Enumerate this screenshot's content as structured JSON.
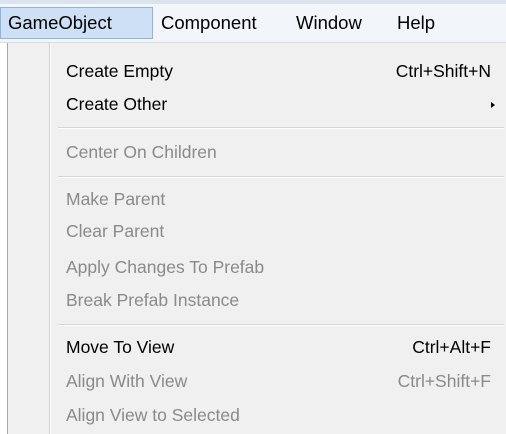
{
  "menubar": {
    "items": [
      {
        "label": "GameObject"
      },
      {
        "label": "Component"
      },
      {
        "label": "Window"
      },
      {
        "label": "Help"
      }
    ]
  },
  "menu": {
    "items": [
      {
        "label": "Create Empty",
        "shortcut": "Ctrl+Shift+N",
        "enabled": true
      },
      {
        "label": "Create Other",
        "shortcut": "",
        "enabled": true,
        "submenu": true
      },
      {
        "label": "Center On Children",
        "shortcut": "",
        "enabled": false
      },
      {
        "label": "Make Parent",
        "shortcut": "",
        "enabled": false
      },
      {
        "label": "Clear Parent",
        "shortcut": "",
        "enabled": false
      },
      {
        "label": "Apply Changes To Prefab",
        "shortcut": "",
        "enabled": false
      },
      {
        "label": "Break Prefab Instance",
        "shortcut": "",
        "enabled": false
      },
      {
        "label": "Move To View",
        "shortcut": "Ctrl+Alt+F",
        "enabled": true
      },
      {
        "label": "Align With View",
        "shortcut": "Ctrl+Shift+F",
        "enabled": false
      },
      {
        "label": "Align View to Selected",
        "shortcut": "",
        "enabled": false
      }
    ]
  },
  "colors": {
    "active_menu_bg": "#cde0f5",
    "active_menu_border": "#8fb3dc",
    "disabled_text": "#8a8a8a"
  }
}
